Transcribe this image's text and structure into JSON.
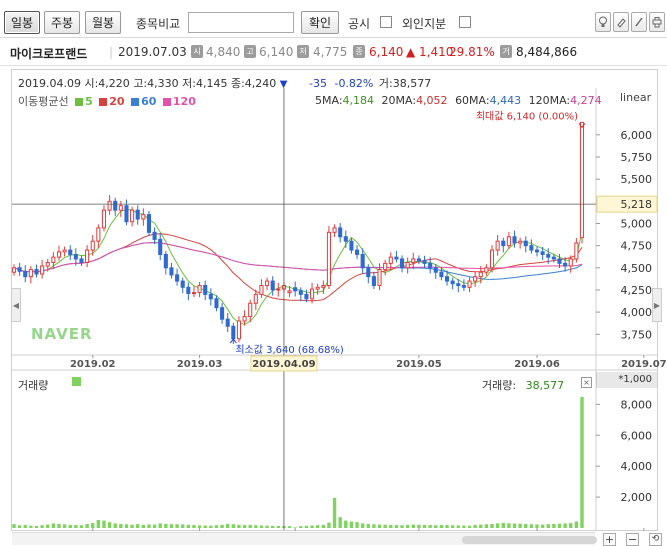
{
  "toolbar": {
    "tabs": [
      {
        "label": "일봉",
        "active": true
      },
      {
        "label": "주봉",
        "active": false
      },
      {
        "label": "월봉",
        "active": false
      }
    ],
    "compare_label": "종목비교",
    "compare_input": "",
    "confirm_label": "확인",
    "disclosure_label": "공시",
    "foreign_label": "외인지분",
    "right_icons": [
      "lightbulb-icon",
      "eraser-icon",
      "edit-icon",
      "print-icon"
    ]
  },
  "info": {
    "stock_name": "마이크로프랜드",
    "date": "2019.07.03",
    "open_badge": "시",
    "open": "4,840",
    "high_badge": "고",
    "high": "6,140",
    "low_badge": "저",
    "low": "4,775",
    "close_badge": "종",
    "close": "6,140",
    "change": "▲ 1,410",
    "change_pct": "29.81%",
    "volume_badge": "거",
    "volume": "8,484,866"
  },
  "cursor": {
    "date": "2019.04.09",
    "open": "시:4,220",
    "high": "고:4,330",
    "low": "저:4,145",
    "close": "종:4,240",
    "arrow": "▼",
    "change": "-35",
    "change_pct": "-0.82%",
    "volume": "거:38,577",
    "x_label": "2019.04.09"
  },
  "ma_legend": {
    "title": "이동평균선",
    "items": [
      {
        "label": "5",
        "color": "#6cbf3f"
      },
      {
        "label": "20",
        "color": "#d6423d"
      },
      {
        "label": "60",
        "color": "#3b7fd1"
      },
      {
        "label": "120",
        "color": "#e352a8"
      }
    ]
  },
  "ma_values": [
    {
      "label": "5MA:",
      "value": "4,184",
      "color": "#3f8f1f"
    },
    {
      "label": "20MA:",
      "value": "4,052",
      "color": "#c7302a"
    },
    {
      "label": "60MA:",
      "value": "4,443",
      "color": "#2f68b5"
    },
    {
      "label": "120MA:",
      "value": "4,274",
      "color": "#cc3c92"
    }
  ],
  "scale_mode": "linear",
  "annotations": {
    "max_text": "최대값 6,140 (0.00%)",
    "min_text": "최소값 3,640 (68.68%)",
    "crosshair_price": "5,218"
  },
  "volume_panel": {
    "label": "거래량",
    "right_label": "거래량:",
    "right_value": "38,577",
    "unit": "*1,000",
    "close_glyph": "×"
  },
  "watermark": "NAVER",
  "chart_data": [
    {
      "type": "candlestick",
      "title": "",
      "y_ticks": [
        "3,750",
        "4,000",
        "4,250",
        "4,500",
        "4,750",
        "5,000",
        "5,250",
        "5,500",
        "5,750",
        "6,000"
      ],
      "ylim": [
        3550,
        6280
      ],
      "x_ticks": [
        "2019.02",
        "2019.03",
        "20",
        "2019.05",
        "2019.06",
        "2019.07"
      ],
      "x_tick_index": [
        14,
        33,
        50,
        72,
        93,
        112
      ],
      "close": [
        4500,
        4460,
        4400,
        4480,
        4430,
        4520,
        4560,
        4620,
        4680,
        4700,
        4650,
        4600,
        4560,
        4700,
        4800,
        4950,
        5150,
        5250,
        5150,
        5200,
        5020,
        5150,
        5050,
        5100,
        4900,
        4820,
        4650,
        4500,
        4420,
        4350,
        4280,
        4210,
        4220,
        4300,
        4200,
        4150,
        4050,
        3920,
        3840,
        3700,
        3900,
        3950,
        4100,
        4200,
        4300,
        4350,
        4250,
        4260,
        4300,
        4240,
        4240,
        4200,
        4150,
        4260,
        4280,
        4300,
        4900,
        4950,
        4850,
        4800,
        4700,
        4650,
        4500,
        4400,
        4300,
        4480,
        4550,
        4620,
        4600,
        4500,
        4560,
        4600,
        4580,
        4550,
        4500,
        4450,
        4400,
        4350,
        4320,
        4300,
        4280,
        4350,
        4400,
        4450,
        4500,
        4700,
        4800,
        4750,
        4850,
        4780,
        4800,
        4750,
        4700,
        4680,
        4650,
        4620,
        4600,
        4550,
        4520,
        4600,
        4780,
        6140
      ],
      "open": [
        4450,
        4500,
        4460,
        4400,
        4480,
        4430,
        4520,
        4560,
        4620,
        4680,
        4700,
        4650,
        4600,
        4560,
        4700,
        4800,
        4950,
        5150,
        5250,
        5150,
        5200,
        5020,
        5150,
        5050,
        5100,
        4900,
        4820,
        4650,
        4500,
        4420,
        4350,
        4280,
        4210,
        4220,
        4300,
        4200,
        4150,
        4050,
        3920,
        3840,
        3700,
        3900,
        3950,
        4100,
        4200,
        4300,
        4350,
        4250,
        4260,
        4220,
        4275,
        4240,
        4200,
        4150,
        4260,
        4280,
        4300,
        4900,
        4950,
        4850,
        4800,
        4700,
        4650,
        4500,
        4400,
        4300,
        4480,
        4550,
        4620,
        4600,
        4500,
        4560,
        4600,
        4580,
        4550,
        4500,
        4450,
        4400,
        4350,
        4320,
        4300,
        4280,
        4350,
        4400,
        4450,
        4500,
        4700,
        4800,
        4750,
        4850,
        4780,
        4800,
        4750,
        4700,
        4680,
        4650,
        4620,
        4600,
        4550,
        4520,
        4600,
        4840
      ],
      "min": 3640,
      "max": 6140
    },
    {
      "type": "bar",
      "title": "거래량",
      "y_ticks": [
        "2,000",
        "4,000",
        "6,000",
        "8,000"
      ],
      "ylim": [
        0,
        8800
      ],
      "unit": "*1,000",
      "values": [
        250,
        180,
        200,
        150,
        130,
        180,
        220,
        300,
        260,
        240,
        200,
        190,
        180,
        260,
        320,
        520,
        480,
        380,
        300,
        260,
        240,
        210,
        250,
        200,
        230,
        220,
        300,
        260,
        250,
        240,
        230,
        200,
        190,
        170,
        160,
        150,
        180,
        200,
        260,
        240,
        210,
        190,
        200,
        180,
        160,
        150,
        140,
        130,
        120,
        115,
        39,
        120,
        140,
        160,
        180,
        200,
        350,
        1950,
        700,
        480,
        420,
        380,
        300,
        260,
        240,
        220,
        210,
        200,
        190,
        180,
        200,
        220,
        210,
        200,
        190,
        180,
        200,
        190,
        180,
        170,
        160,
        150,
        200,
        220,
        240,
        260,
        300,
        330,
        310,
        290,
        280,
        260,
        240,
        230,
        220,
        250,
        260,
        280,
        300,
        320,
        420,
        8480
      ]
    }
  ]
}
